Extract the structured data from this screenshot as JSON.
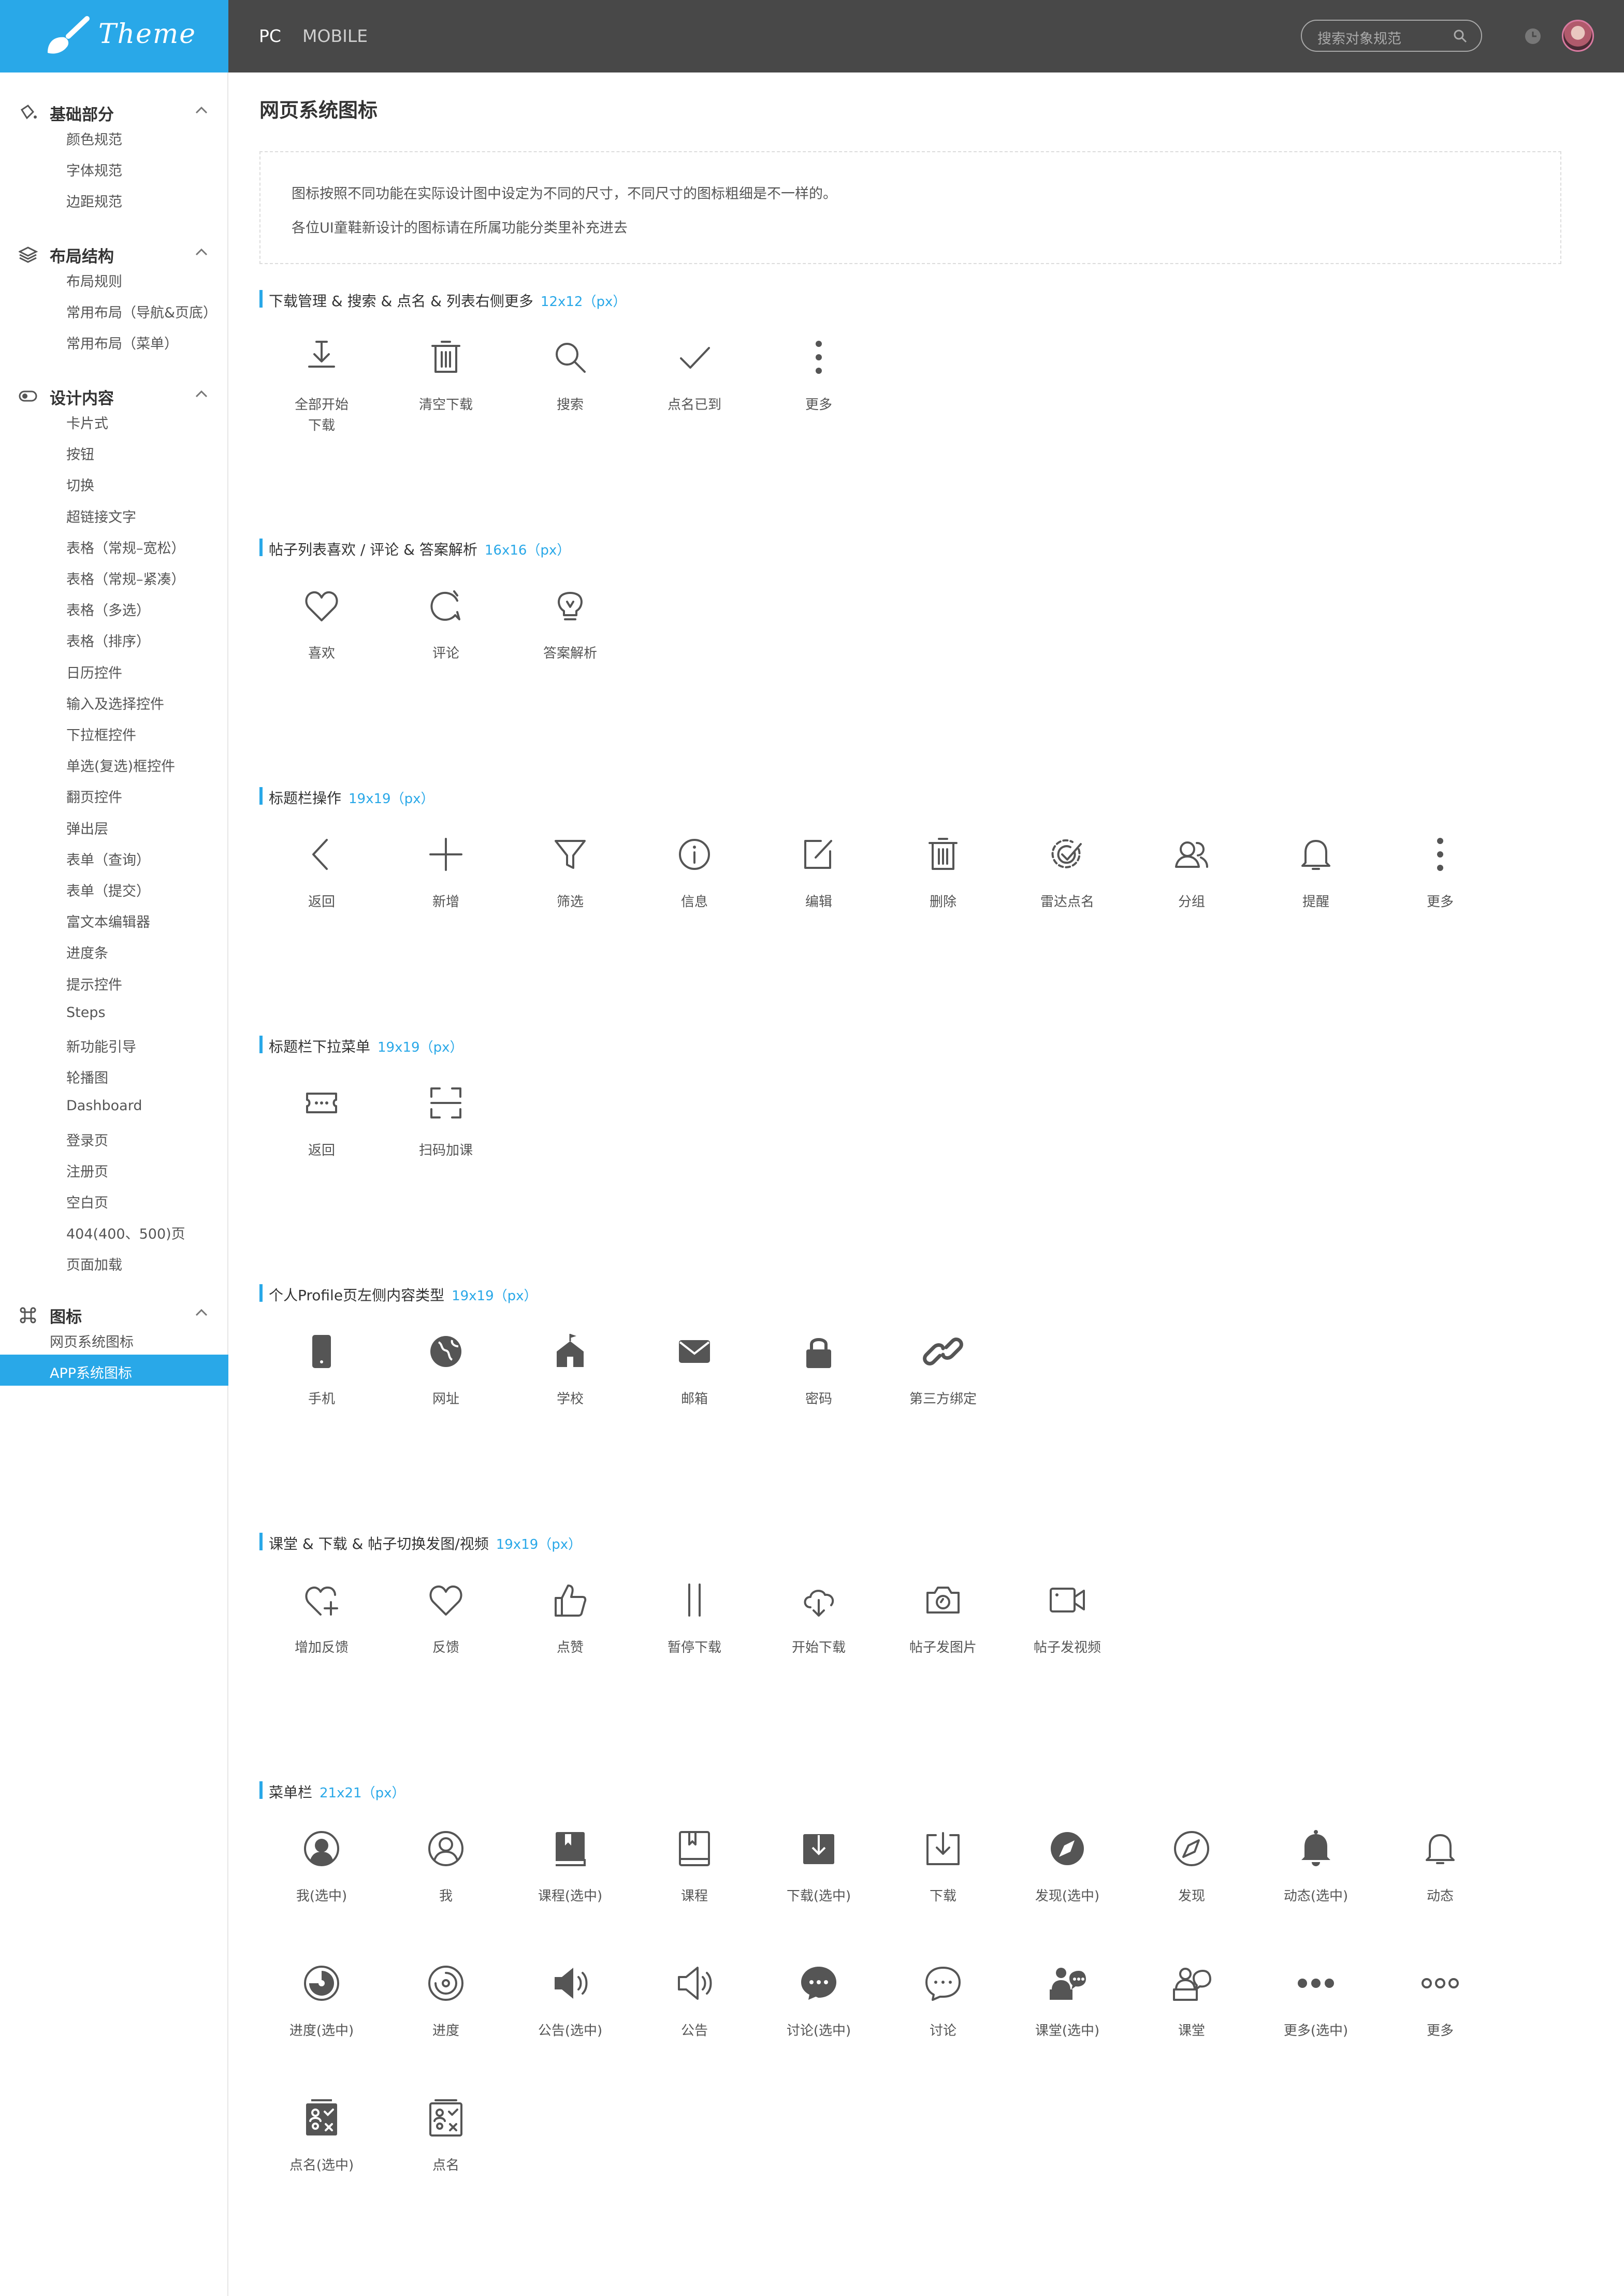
{
  "topbar": {
    "logo_text": "Theme",
    "tabs": [
      "PC",
      "MOBILE"
    ],
    "search_placeholder": "搜索对象规范"
  },
  "sidebar": {
    "groups": [
      {
        "label": "基础部分",
        "icon": "paint-bucket-icon",
        "items": [
          "颜色规范",
          "字体规范",
          "边距规范"
        ]
      },
      {
        "label": "布局结构",
        "icon": "layers-icon",
        "items": [
          "布局规则",
          "常用布局（导航&页底）",
          "常用布局（菜单）"
        ]
      },
      {
        "label": "设计内容",
        "icon": "toggle-icon",
        "items": [
          "卡片式",
          "按钮",
          "切换",
          "超链接文字",
          "表格（常规–宽松）",
          "表格（常规–紧凑）",
          "表格（多选）",
          "表格（排序）",
          "日历控件",
          "输入及选择控件",
          "下拉框控件",
          "单选(复选)框控件",
          "翻页控件",
          "弹出层",
          "表单（查询）",
          "表单（提交）",
          "富文本编辑器",
          "进度条",
          "提示控件",
          "Steps",
          "新功能引导",
          "轮播图",
          "Dashboard",
          "登录页",
          "注册页",
          "空白页",
          "404(400、500)页",
          "页面加载"
        ]
      },
      {
        "label": "图标",
        "icon": "command-icon",
        "items": [
          "网页系统图标",
          "APP系统图标"
        ]
      }
    ],
    "active_item": "APP系统图标"
  },
  "main": {
    "title": "网页系统图标",
    "notice": [
      "图标按照不同功能在实际设计图中设定为不同的尺寸，不同尺寸的图标粗细是不一样的。",
      "各位UI童鞋新设计的图标请在所属功能分类里补充进去"
    ],
    "sections": [
      {
        "title": "下载管理 & 搜索 & 点名 & 列表右侧更多",
        "size": "12x12（px）",
        "icons": [
          {
            "name": "download-icon",
            "label": "全部开始下载"
          },
          {
            "name": "trash-icon",
            "label": "清空下载"
          },
          {
            "name": "search-icon",
            "label": "搜索"
          },
          {
            "name": "check-icon",
            "label": "点名已到"
          },
          {
            "name": "more-vertical-icon",
            "label": "更多"
          }
        ]
      },
      {
        "title": "帖子列表喜欢 / 评论 & 答案解析",
        "size": "16x16（px）",
        "icons": [
          {
            "name": "heart-icon",
            "label": "喜欢"
          },
          {
            "name": "comment-icon",
            "label": "评论"
          },
          {
            "name": "bulb-icon",
            "label": "答案解析"
          }
        ]
      },
      {
        "title": "标题栏操作",
        "size": "19x19（px）",
        "icons": [
          {
            "name": "back-icon",
            "label": "返回"
          },
          {
            "name": "plus-icon",
            "label": "新增"
          },
          {
            "name": "filter-icon",
            "label": "筛选"
          },
          {
            "name": "info-icon",
            "label": "信息"
          },
          {
            "name": "edit-icon",
            "label": "编辑"
          },
          {
            "name": "trash-icon",
            "label": "删除"
          },
          {
            "name": "radar-icon",
            "label": "雷达点名"
          },
          {
            "name": "group-icon",
            "label": "分组"
          },
          {
            "name": "bell-icon",
            "label": "提醒"
          },
          {
            "name": "more-vertical-icon",
            "label": "更多"
          }
        ]
      },
      {
        "title": "标题栏下拉菜单",
        "size": "19x19（px）",
        "icons": [
          {
            "name": "ticket-icon",
            "label": "返回"
          },
          {
            "name": "scan-icon",
            "label": "扫码加课"
          }
        ]
      },
      {
        "title": "个人Profile页左侧内容类型",
        "size": "19x19（px）",
        "icons": [
          {
            "name": "phone-icon",
            "label": "手机"
          },
          {
            "name": "globe-icon",
            "label": "网址"
          },
          {
            "name": "school-icon",
            "label": "学校"
          },
          {
            "name": "mail-icon",
            "label": "邮箱"
          },
          {
            "name": "lock-icon",
            "label": "密码"
          },
          {
            "name": "link-icon",
            "label": "第三方绑定"
          }
        ]
      },
      {
        "title": "课堂 & 下载 & 帖子切换发图/视频",
        "size": "19x19（px）",
        "icons": [
          {
            "name": "heart-plus-icon",
            "label": "增加反馈"
          },
          {
            "name": "heart-icon",
            "label": "反馈"
          },
          {
            "name": "thumb-up-icon",
            "label": "点赞"
          },
          {
            "name": "pause-icon",
            "label": "暂停下载"
          },
          {
            "name": "cloud-download-icon",
            "label": "开始下载"
          },
          {
            "name": "camera-icon",
            "label": "帖子发图片"
          },
          {
            "name": "video-icon",
            "label": "帖子发视频"
          }
        ]
      },
      {
        "title": "菜单栏",
        "size": "21x21（px）",
        "icons": [
          {
            "name": "user-filled-icon",
            "label": "我(选中)"
          },
          {
            "name": "user-icon",
            "label": "我"
          },
          {
            "name": "book-filled-icon",
            "label": "课程(选中)"
          },
          {
            "name": "book-icon",
            "label": "课程"
          },
          {
            "name": "download-box-filled-icon",
            "label": "下载(选中)"
          },
          {
            "name": "download-box-icon",
            "label": "下载"
          },
          {
            "name": "compass-filled-icon",
            "label": "发现(选中)"
          },
          {
            "name": "compass-icon",
            "label": "发现"
          },
          {
            "name": "bell-filled-icon",
            "label": "动态(选中)"
          },
          {
            "name": "bell-icon",
            "label": "动态"
          },
          {
            "name": "progress-filled-icon",
            "label": "进度(选中)"
          },
          {
            "name": "progress-icon",
            "label": "进度"
          },
          {
            "name": "speaker-filled-icon",
            "label": "公告(选中)"
          },
          {
            "name": "speaker-icon",
            "label": "公告"
          },
          {
            "name": "chat-filled-icon",
            "label": "讨论(选中)"
          },
          {
            "name": "chat-icon",
            "label": "讨论"
          },
          {
            "name": "classroom-filled-icon",
            "label": "课堂(选中)"
          },
          {
            "name": "classroom-icon",
            "label": "课堂"
          },
          {
            "name": "more-horizontal-filled-icon",
            "label": "更多(选中)"
          },
          {
            "name": "more-horizontal-icon",
            "label": "更多"
          },
          {
            "name": "rollcall-filled-icon",
            "label": "点名(选中)"
          },
          {
            "name": "rollcall-icon",
            "label": "点名"
          }
        ]
      }
    ]
  },
  "colors": {
    "accent": "#29a8e8",
    "topbar": "#484848",
    "icon": "#555555"
  }
}
